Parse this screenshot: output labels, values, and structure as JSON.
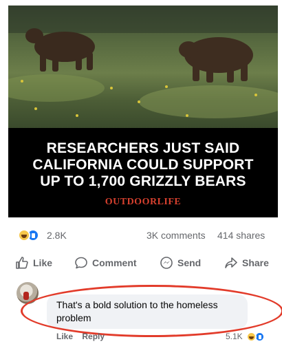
{
  "post": {
    "headline": "RESEARCHERS JUST SAID\nCALIFORNIA COULD SUPPORT\nUP TO 1,700 GRIZZLY BEARS",
    "publisher": "OUTDOORLIFE"
  },
  "stats": {
    "reactions": "2.8K",
    "comments": "3K comments",
    "shares": "414 shares"
  },
  "actions": {
    "like": "Like",
    "comment": "Comment",
    "send": "Send",
    "share": "Share"
  },
  "comment": {
    "text": "That's a bold solution to the homeless problem",
    "like_label": "Like",
    "reply_label": "Reply",
    "reaction_count": "5.1K"
  },
  "colors": {
    "accent_blue": "#1877f2",
    "highlight_red": "#e23b2a",
    "publisher_red": "#d8412f"
  },
  "icons": [
    "haha-reaction-icon",
    "like-reaction-icon",
    "thumbs-up-icon",
    "comment-icon",
    "messenger-icon",
    "share-arrow-icon"
  ]
}
